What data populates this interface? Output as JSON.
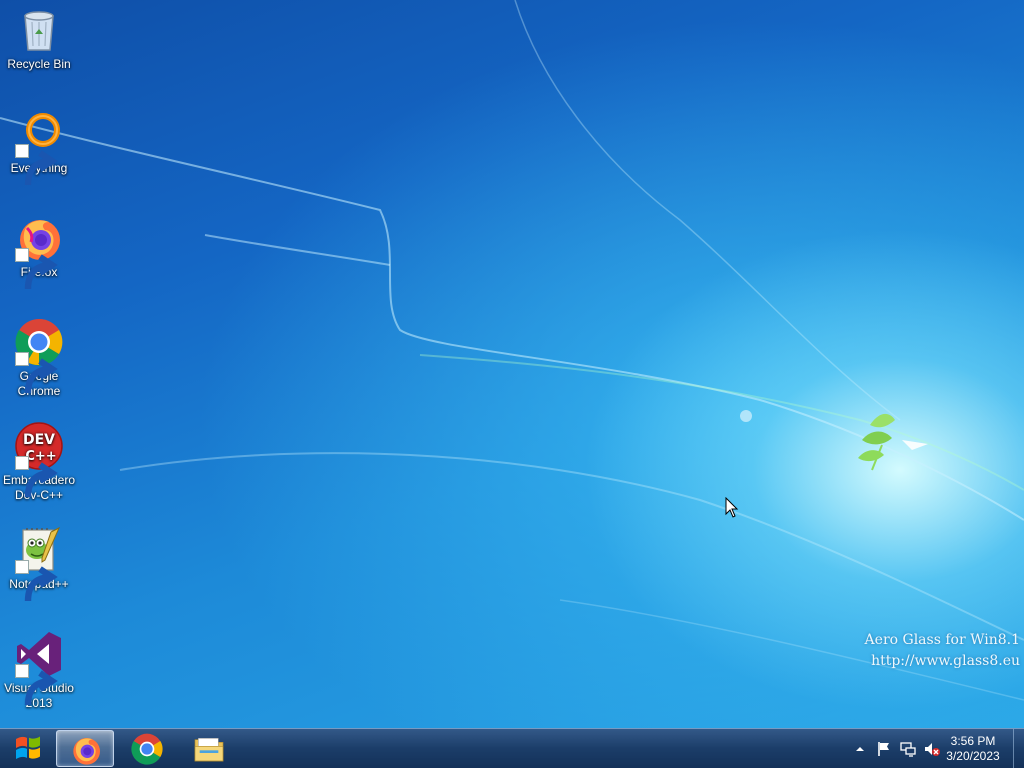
{
  "desktop": {
    "icons": [
      {
        "label": "Recycle Bin",
        "icon": "recycle-bin-icon"
      },
      {
        "label": "Everything",
        "icon": "everything-icon"
      },
      {
        "label": "Firefox",
        "icon": "firefox-icon"
      },
      {
        "label": "Google Chrome",
        "icon": "chrome-icon"
      },
      {
        "label": "Embarcadero Dev-C++",
        "icon": "devcpp-icon"
      },
      {
        "label": "Notepad++",
        "icon": "notepadpp-icon"
      },
      {
        "label": "Visual Studio 2013",
        "icon": "visual-studio-icon"
      }
    ],
    "devcpp_badge_top": "DEV",
    "devcpp_badge_bottom": "C++",
    "watermark": {
      "line1": "Aero Glass for Win8.1",
      "line2": "http://www.glass8.eu"
    }
  },
  "taskbar": {
    "start": {
      "icon": "windows-start-icon"
    },
    "pinned": [
      {
        "name": "Firefox",
        "icon": "firefox-icon",
        "active": true
      },
      {
        "name": "Google Chrome",
        "icon": "chrome-icon",
        "active": false
      },
      {
        "name": "File Explorer",
        "icon": "folder-icon",
        "active": false
      }
    ],
    "tray": {
      "icons": [
        "show-hidden-icons-arrow-icon",
        "action-center-flag-icon",
        "network-icon",
        "volume-muted-icon"
      ],
      "time": "3:56 PM",
      "date": "3/20/2023"
    }
  },
  "colors": {
    "desktop_blue": "#1466c4",
    "taskbar": "#1a3a66",
    "firefox_orange": "#ff7139",
    "chrome_red": "#db4437",
    "chrome_yellow": "#f4b400",
    "chrome_green": "#0f9d58",
    "chrome_blue": "#4285f4",
    "vs_purple": "#68217a",
    "devcpp_red": "#d42a2a"
  }
}
